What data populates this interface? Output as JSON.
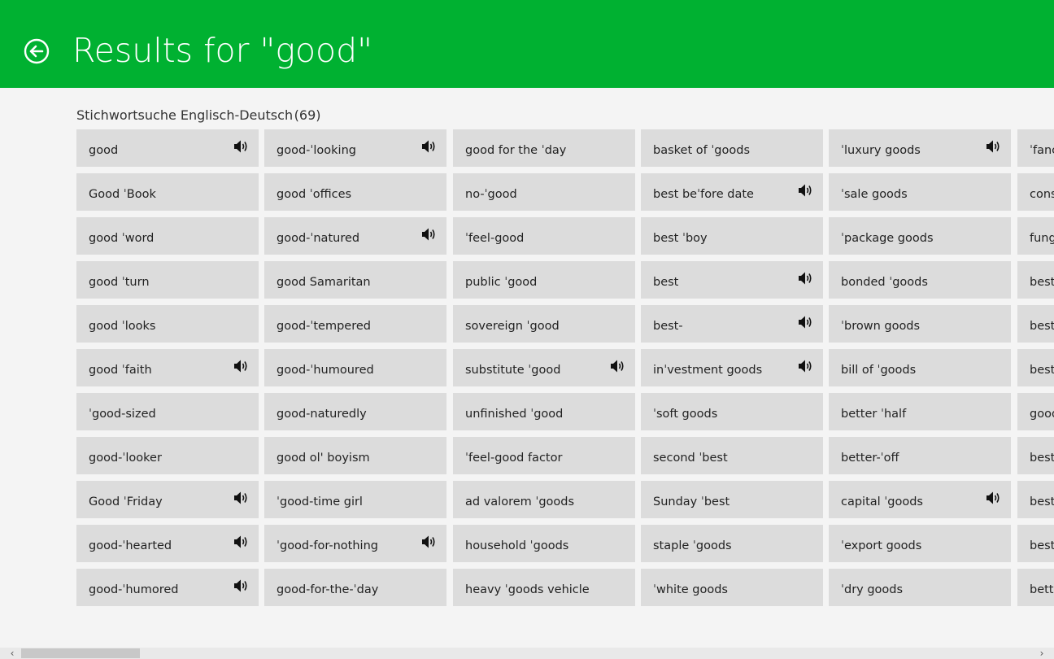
{
  "header": {
    "title": "Results for \"good\"",
    "back_icon": "back-arrow-circle-icon",
    "background_color": "#00b131"
  },
  "section": {
    "title": "Stichwortsuche Englisch-Deutsch (69)"
  },
  "speaker_icon": "speaker-icon",
  "columns": [
    [
      {
        "label": "good",
        "audio": true
      },
      {
        "label": "Good ˈBook",
        "audio": false
      },
      {
        "label": "good ˈword",
        "audio": false
      },
      {
        "label": "good ˈturn",
        "audio": false
      },
      {
        "label": "good ˈlooks",
        "audio": false
      },
      {
        "label": "good ˈfaith",
        "audio": true
      },
      {
        "label": "ˈgood-sized",
        "audio": false
      },
      {
        "label": "good-ˈlooker",
        "audio": false
      },
      {
        "label": "Good ˈFriday",
        "audio": true
      },
      {
        "label": "good-ˈhearted",
        "audio": true
      },
      {
        "label": "good-ˈhumored",
        "audio": true
      }
    ],
    [
      {
        "label": "good-ˈlooking",
        "audio": true
      },
      {
        "label": "good ˈoffices",
        "audio": false
      },
      {
        "label": "good-ˈnatured",
        "audio": true
      },
      {
        "label": "good Samaritan",
        "audio": false
      },
      {
        "label": "good-ˈtempered",
        "audio": false
      },
      {
        "label": "good-ˈhumoured",
        "audio": false
      },
      {
        "label": "good-naturedly",
        "audio": false
      },
      {
        "label": "good ol' boyism",
        "audio": false
      },
      {
        "label": "ˈgood-time girl",
        "audio": false
      },
      {
        "label": "ˈgood-for-nothing",
        "audio": true
      },
      {
        "label": "good-for-the-ˈday",
        "audio": false
      }
    ],
    [
      {
        "label": "good for the ˈday",
        "audio": false
      },
      {
        "label": "no-ˈgood",
        "audio": false
      },
      {
        "label": "ˈfeel-good",
        "audio": false
      },
      {
        "label": "public ˈgood",
        "audio": false
      },
      {
        "label": "sovereign ˈgood",
        "audio": false
      },
      {
        "label": "substitute ˈgood",
        "audio": true
      },
      {
        "label": "unfinished ˈgood",
        "audio": false
      },
      {
        "label": "ˈfeel-good factor",
        "audio": false
      },
      {
        "label": "ad valorem ˈgoods",
        "audio": false
      },
      {
        "label": "household ˈgoods",
        "audio": false
      },
      {
        "label": "heavy ˈgoods vehicle",
        "audio": false
      }
    ],
    [
      {
        "label": "basket of ˈgoods",
        "audio": false
      },
      {
        "label": "best beˈfore date",
        "audio": true
      },
      {
        "label": "best ˈboy",
        "audio": false
      },
      {
        "label": "best",
        "audio": true
      },
      {
        "label": "best-",
        "audio": true
      },
      {
        "label": "inˈvestment goods",
        "audio": true
      },
      {
        "label": "ˈsoft goods",
        "audio": false
      },
      {
        "label": "second ˈbest",
        "audio": false
      },
      {
        "label": "Sunday ˈbest",
        "audio": false
      },
      {
        "label": "staple ˈgoods",
        "audio": false
      },
      {
        "label": "ˈwhite goods",
        "audio": false
      }
    ],
    [
      {
        "label": "ˈluxury goods",
        "audio": true
      },
      {
        "label": "ˈsale goods",
        "audio": false
      },
      {
        "label": "ˈpackage goods",
        "audio": false
      },
      {
        "label": "bonded ˈgoods",
        "audio": false
      },
      {
        "label": "ˈbrown goods",
        "audio": false
      },
      {
        "label": "bill of ˈgoods",
        "audio": false
      },
      {
        "label": "better ˈhalf",
        "audio": false
      },
      {
        "label": "better-ˈoff",
        "audio": false
      },
      {
        "label": "capital ˈgoods",
        "audio": true
      },
      {
        "label": "ˈexport goods",
        "audio": false
      },
      {
        "label": "ˈdry goods",
        "audio": false
      }
    ],
    [
      {
        "label": "ˈfanc",
        "audio": false
      },
      {
        "label": "cons",
        "audio": false
      },
      {
        "label": "fung",
        "audio": false
      },
      {
        "label": "best",
        "audio": false
      },
      {
        "label": "best-",
        "audio": false
      },
      {
        "label": "best",
        "audio": false
      },
      {
        "label": "good",
        "audio": false
      },
      {
        "label": "best-",
        "audio": false
      },
      {
        "label": "best-",
        "audio": false
      },
      {
        "label": "best-",
        "audio": false
      },
      {
        "label": "bette",
        "audio": false
      }
    ]
  ],
  "scrollbar": {
    "left_arrow": "‹",
    "right_arrow": "›"
  }
}
